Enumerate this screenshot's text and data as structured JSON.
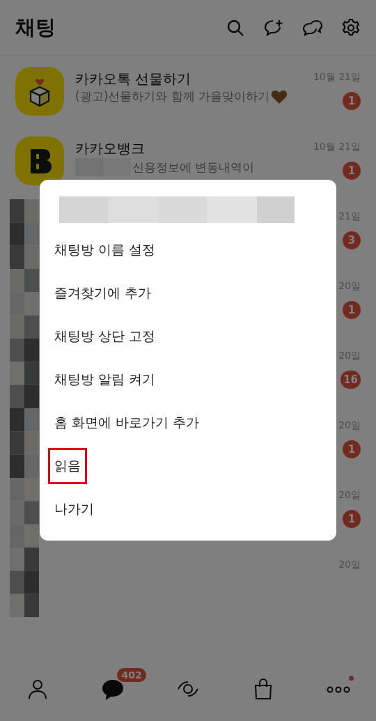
{
  "header": {
    "title": "채팅"
  },
  "chats": [
    {
      "kind": "gift",
      "name": "카카오톡 선물하기",
      "preview": "(광고)선물하기와 함께 가을맞이하기",
      "time": "10월 21일",
      "badge": "1"
    },
    {
      "kind": "bank",
      "name": "카카오뱅크",
      "preview": "신용정보에 변동내역이",
      "time": "10월 21일",
      "badge": "1"
    },
    {
      "kind": "blurred",
      "time": "21일",
      "badge": "3"
    },
    {
      "kind": "blurred",
      "time": "20일",
      "badge": "1"
    },
    {
      "kind": "blurred",
      "time": "20일",
      "badge": "16"
    },
    {
      "kind": "blurred",
      "time": "20일",
      "badge": "1"
    },
    {
      "kind": "blurred",
      "time": "20일",
      "badge": "1"
    },
    {
      "kind": "blurred",
      "time": "20일"
    }
  ],
  "menu": {
    "items": [
      {
        "label": "채팅방 이름 설정",
        "highlighted": false
      },
      {
        "label": "즐겨찾기에 추가",
        "highlighted": false
      },
      {
        "label": "채팅방 상단 고정",
        "highlighted": false
      },
      {
        "label": "채팅방 알림 켜기",
        "highlighted": false
      },
      {
        "label": "홈 화면에 바로가기 추가",
        "highlighted": false
      },
      {
        "label": "읽음",
        "highlighted": true
      },
      {
        "label": "나가기",
        "highlighted": false
      }
    ]
  },
  "nav": [
    {
      "kind": "friends",
      "selected": false
    },
    {
      "kind": "chats",
      "selected": true,
      "badge": "402"
    },
    {
      "kind": "view",
      "selected": false
    },
    {
      "kind": "shopping",
      "selected": false
    },
    {
      "kind": "more",
      "selected": false,
      "dot": true
    }
  ]
}
